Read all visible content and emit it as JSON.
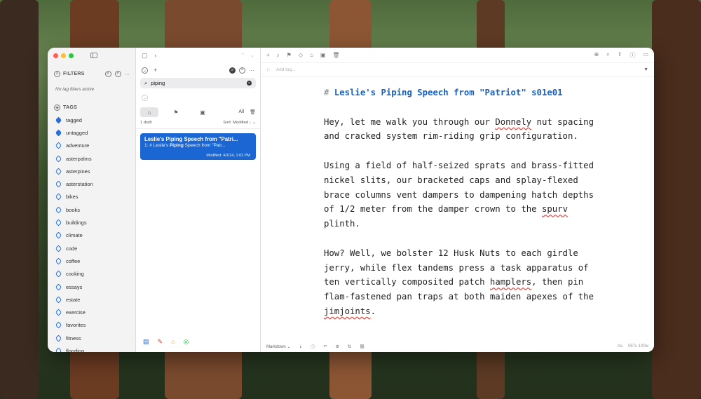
{
  "sidebar": {
    "filters_label": "FILTERS",
    "no_filters": "No tag filters active",
    "tags_label": "TAGS",
    "tags": [
      {
        "label": "tagged",
        "solid": true
      },
      {
        "label": "untagged",
        "solid": true
      },
      {
        "label": "adventure"
      },
      {
        "label": "asterpalms"
      },
      {
        "label": "asterpines"
      },
      {
        "label": "asterstation"
      },
      {
        "label": "bikes"
      },
      {
        "label": "books"
      },
      {
        "label": "buildings"
      },
      {
        "label": "climate"
      },
      {
        "label": "code"
      },
      {
        "label": "coffee"
      },
      {
        "label": "cooking"
      },
      {
        "label": "essays"
      },
      {
        "label": "estate"
      },
      {
        "label": "exercise"
      },
      {
        "label": "favorites"
      },
      {
        "label": "fitness"
      },
      {
        "label": "flooding"
      }
    ]
  },
  "notelist": {
    "search_value": "piping",
    "count": "1 draft",
    "sort": "Sort: Modified ↓ ⌄",
    "all_label": "All",
    "note": {
      "title": "Leslie's Piping Speech from \"Patri...",
      "snippet_prefix": "1: # Leslie's ",
      "snippet_match": "Piping",
      "snippet_suffix": " Speech from \"Patr...",
      "modified": "Modified: 4/1/24, 1:02 PM"
    }
  },
  "editor": {
    "tag_placeholder": "Add tag...",
    "heading_hash": "#",
    "heading": "Leslie's Piping Speech from \"Patriot\" s01e01",
    "p1_a": "Hey, let me walk you through our ",
    "p1_sp": "Donnely",
    "p1_b": " nut spacing and cracked system rim-riding grip configuration.",
    "p2_a": "Using a field of half-seized sprats and brass-fitted nickel slits, our bracketed caps and splay-flexed brace columns vent dampers to dampening hatch depths of 1/2 meter from the damper crown to the ",
    "p2_sp": "spurv",
    "p2_b": " plinth.",
    "p3_a": "How? Well, we bolster 12 Husk Nuts to each girdle jerry, while flex tandems press a task apparatus of ten vertically composited patch ",
    "p3_sp1": "hamplers",
    "p3_b": ", then pin flam-fastened pan traps at both maiden apexes of the ",
    "p3_sp2": "jimjoints",
    "p3_c": ".",
    "mode": "Markdown ⌄",
    "font_label": "Aa",
    "counts": "597c 100w"
  },
  "colors": {
    "accent": "#1a66d2",
    "heading": "#1560c2"
  }
}
